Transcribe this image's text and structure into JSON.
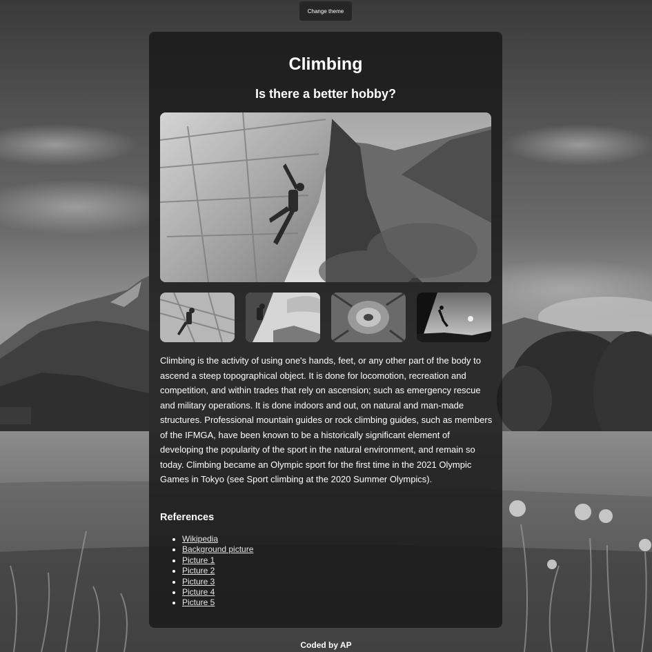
{
  "header": {
    "theme_button_label": "Change theme"
  },
  "card": {
    "title": "Climbing",
    "subtitle": "Is there a better hobby?",
    "paragraph": "Climbing is the activity of using one's hands, feet, or any other part of the body to ascend a steep topographical object. It is done for locomotion, recreation and competition, and within trades that rely on ascension; such as emergency rescue and military operations. It is done indoors and out, on natural and man-made structures. Professional mountain guides or rock climbing guides, such as members of the IFMGA, have been known to be a historically significant element of developing the popularity of the sport in the natural environment, and remain so today. Climbing became an Olympic sport for the first time in the 2021 Olympic Games in Tokyo (see Sport climbing at the 2020 Summer Olympics).",
    "references_title": "References",
    "references": [
      "Wikipedia",
      "Background picture",
      "Picture 1",
      "Picture 2",
      "Picture 3",
      "Picture 4",
      "Picture 5"
    ]
  },
  "footer": {
    "credit": "Coded by AP"
  },
  "colors": {
    "card_background": "#1a1a1a",
    "button_background": "#262626",
    "text": "#ffffff",
    "link": "#e6e6e6"
  },
  "icons": {
    "list_bullet": "disc"
  }
}
